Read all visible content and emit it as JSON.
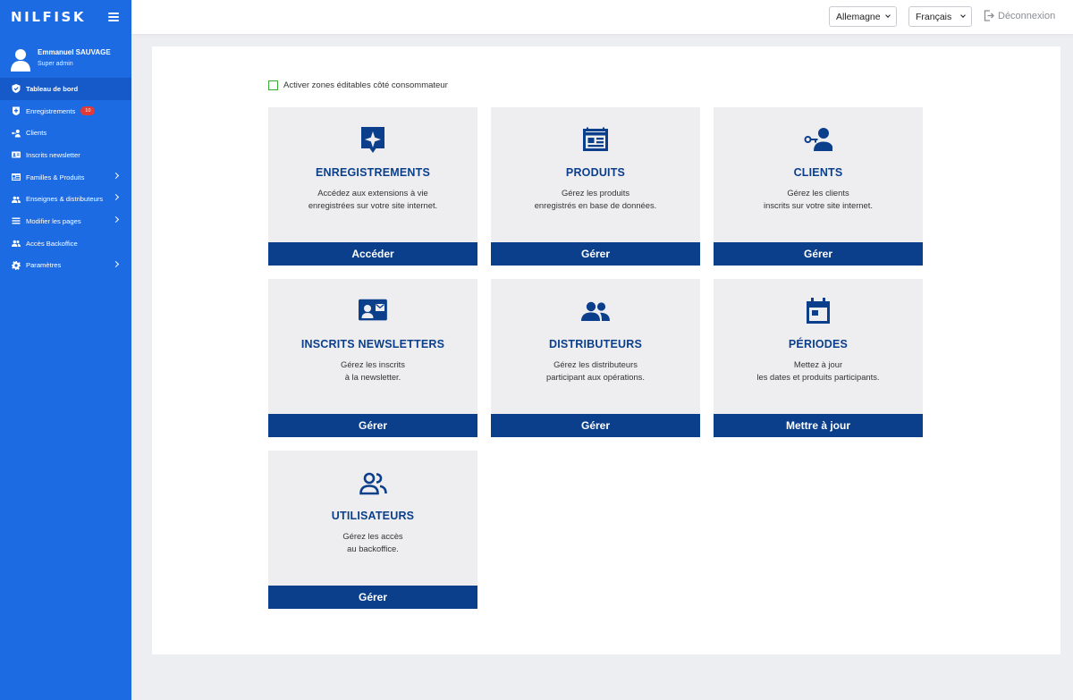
{
  "brand": {
    "logo_text": "NILFISK"
  },
  "user": {
    "name": "Emmanuel SAUVAGE",
    "role": "Super admin"
  },
  "menu": [
    {
      "label": "Tableau de bord",
      "icon": "shield-icon"
    },
    {
      "label": "Enregistrements",
      "icon": "shield-plus-icon",
      "badge": "10"
    },
    {
      "label": "Clients",
      "icon": "user-key-icon"
    },
    {
      "label": "Inscrits newsletter",
      "icon": "contact-card-icon"
    },
    {
      "label": "Familles & Produits",
      "icon": "table-icon"
    },
    {
      "label": "Enseignes & distributeurs",
      "icon": "users-icon"
    },
    {
      "label": "Modifier les pages",
      "icon": "list-icon"
    },
    {
      "label": "Accès Backoffice",
      "icon": "users-icon"
    },
    {
      "label": "Paramètres",
      "icon": "gear-icon"
    }
  ],
  "topbar": {
    "country": "Allemagne",
    "language": "Français",
    "logout_label": "Déconnexion"
  },
  "panel": {
    "checkbox_label": "Activer zones éditables côté consommateur",
    "cards": [
      {
        "title": "ENREGISTREMENTS",
        "desc1": "Accédez aux extensions à vie",
        "desc2": "enregistrées sur votre site internet.",
        "button": "Accéder",
        "icon": "badge-star-icon"
      },
      {
        "title": "PRODUITS",
        "desc1": "Gérez les produits",
        "desc2": "enregistrés en base de données.",
        "button": "Gérer",
        "icon": "table-icon"
      },
      {
        "title": "CLIENTS",
        "desc1": "Gérez les clients",
        "desc2": "inscrits sur votre site internet.",
        "button": "Gérer",
        "icon": "user-key-icon"
      },
      {
        "title": "INSCRITS NEWSLETTERS",
        "desc1": "Gérez les inscrits",
        "desc2": "à la newsletter.",
        "button": "Gérer",
        "icon": "contact-mail-icon"
      },
      {
        "title": "DISTRIBUTEURS",
        "desc1": "Gérez les distributeurs",
        "desc2": "participant aux opérations.",
        "button": "Gérer",
        "icon": "group-icon"
      },
      {
        "title": "PÉRIODES",
        "desc1": "Mettez à jour",
        "desc2": "les dates et produits participants.",
        "button": "Mettre à jour",
        "icon": "calendar-icon"
      },
      {
        "title": "UTILISATEURS",
        "desc1": "Gérez les accès",
        "desc2": "au backoffice.",
        "button": "Gérer",
        "icon": "users-outline-icon"
      }
    ]
  },
  "colors": {
    "sidebar": "#1d6be3",
    "sidebar_active": "#1659c9",
    "primary": "#0b3f8c",
    "card_bg": "#eeeef0",
    "badge": "#e53935",
    "checkbox_border": "#3aaa35"
  }
}
